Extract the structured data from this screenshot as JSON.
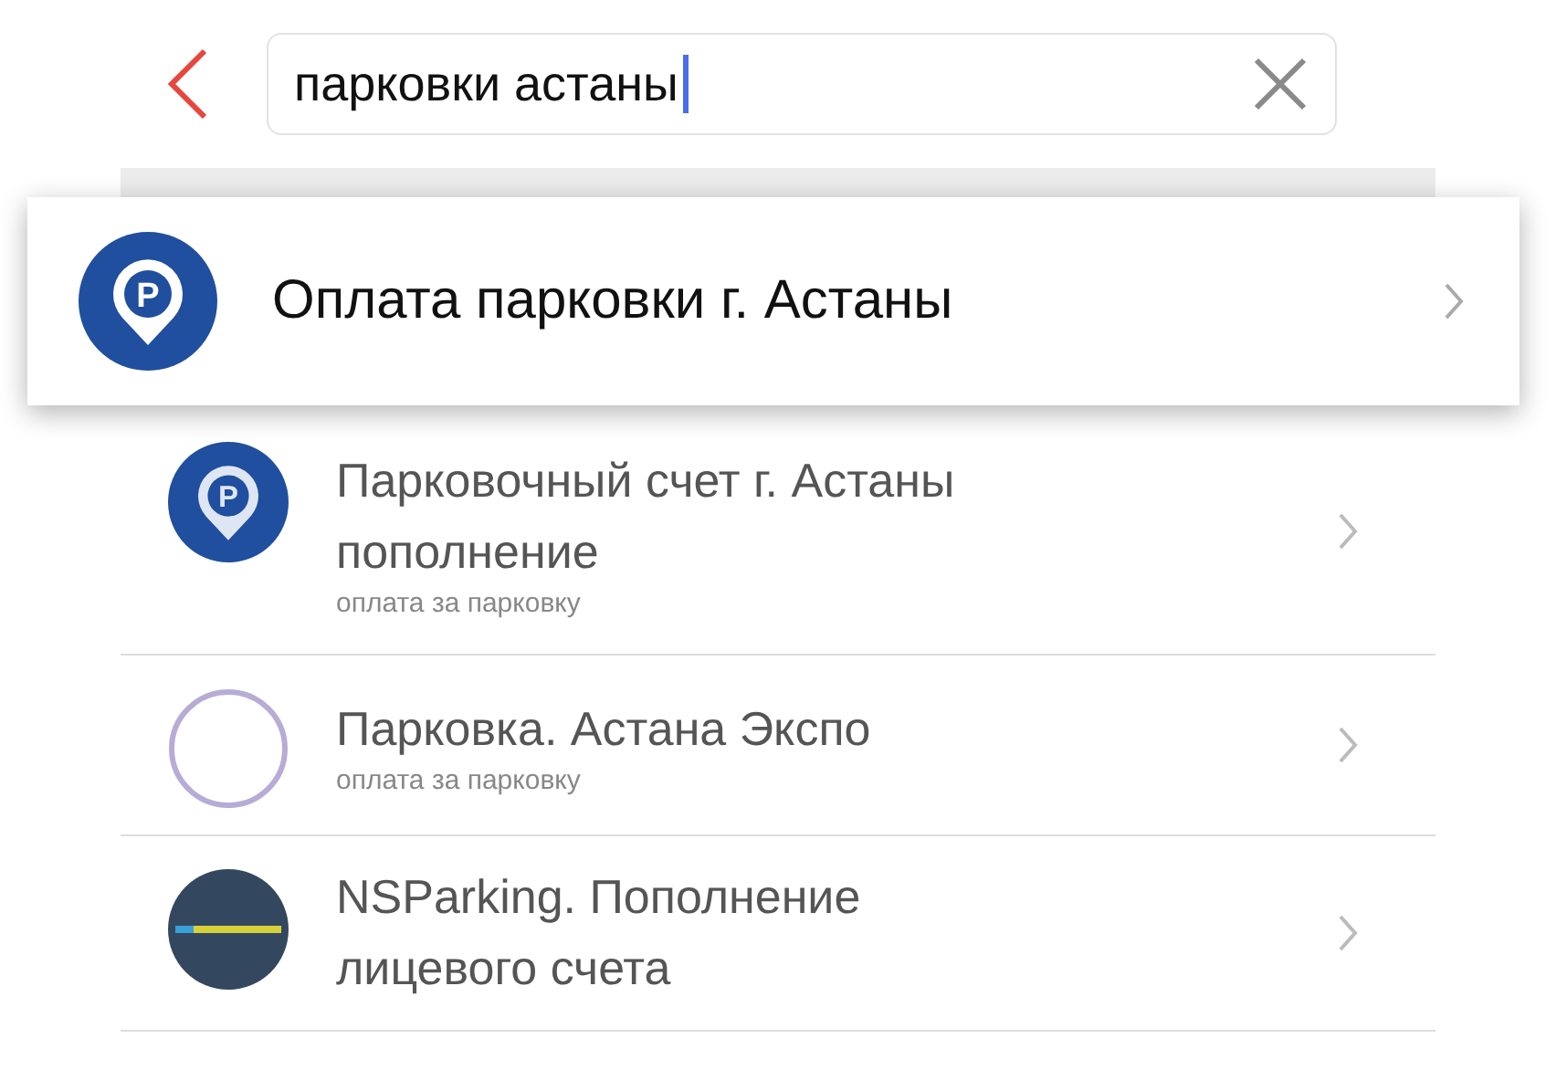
{
  "search": {
    "value": "парковки астаны"
  },
  "featured": {
    "title": "Оплата парковки г. Астаны",
    "badge": "P"
  },
  "results": [
    {
      "title": "Парковочный счет г. Астаны пополнение",
      "subtitle": "оплата за парковку",
      "kind": "pin",
      "badge": "P"
    },
    {
      "title": "Парковка. Астана Экспо",
      "subtitle": "оплата за парковку",
      "kind": "ring"
    },
    {
      "title": "NSParking. Пополнение лицевого счета",
      "kind": "dark"
    }
  ]
}
